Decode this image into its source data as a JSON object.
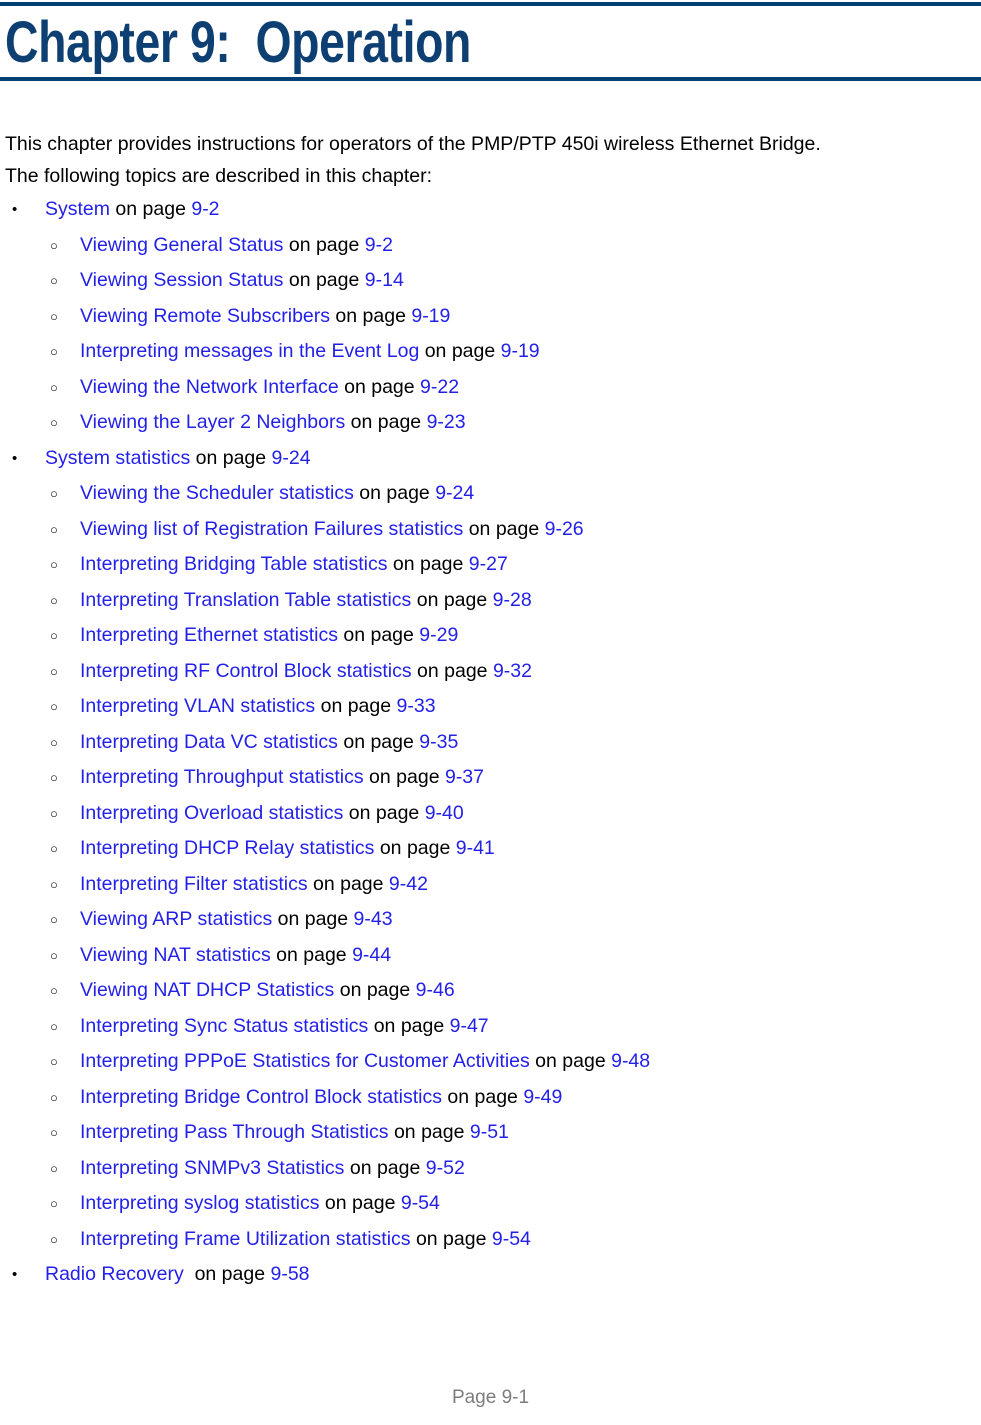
{
  "header": {
    "title": "Chapter 9:  Operation",
    "rule_color": "#024073",
    "title_color": "#0d3f72"
  },
  "intro": {
    "line1": "This chapter provides instructions for operators of the PMP/PTP 450i wireless Ethernet Bridge.",
    "line2": "The following topics are described in this chapter:"
  },
  "colors": {
    "link": "#2321e8",
    "text": "#000000",
    "footer": "#7d7d7d"
  },
  "connector": " on page ",
  "toc": [
    {
      "level": 1,
      "bullet": "•",
      "title": "System",
      "connector": " on page ",
      "page": "9-2"
    },
    {
      "level": 2,
      "bullet": "○",
      "title": "Viewing General Status",
      "connector": " on page ",
      "page": "9-2"
    },
    {
      "level": 2,
      "bullet": "○",
      "title": "Viewing Session Status",
      "connector": " on page ",
      "page": "9-14"
    },
    {
      "level": 2,
      "bullet": "○",
      "title": "Viewing Remote Subscribers",
      "connector": " on page ",
      "page": "9-19"
    },
    {
      "level": 2,
      "bullet": "○",
      "title": "Interpreting messages in the Event Log",
      "connector": " on page ",
      "page": "9-19"
    },
    {
      "level": 2,
      "bullet": "○",
      "title": "Viewing the Network Interface",
      "connector": " on page ",
      "page": "9-22"
    },
    {
      "level": 2,
      "bullet": "○",
      "title": "Viewing the Layer 2 Neighbors",
      "connector": " on page ",
      "page": "9-23"
    },
    {
      "level": 1,
      "bullet": "•",
      "title": "System statistics",
      "connector": " on page ",
      "page": "9-24"
    },
    {
      "level": 2,
      "bullet": "○",
      "title": "Viewing the Scheduler statistics",
      "connector": " on page ",
      "page": "9-24"
    },
    {
      "level": 2,
      "bullet": "○",
      "title": "Viewing list of Registration Failures statistics",
      "connector": " on page ",
      "page": "9-26"
    },
    {
      "level": 2,
      "bullet": "○",
      "title": "Interpreting Bridging Table statistics",
      "connector": " on page ",
      "page": "9-27"
    },
    {
      "level": 2,
      "bullet": "○",
      "title": "Interpreting Translation Table statistics",
      "connector": " on page ",
      "page": "9-28"
    },
    {
      "level": 2,
      "bullet": "○",
      "title": "Interpreting Ethernet statistics",
      "connector": " on page ",
      "page": "9-29"
    },
    {
      "level": 2,
      "bullet": "○",
      "title": "Interpreting RF Control Block statistics",
      "connector": " on page ",
      "page": "9-32"
    },
    {
      "level": 2,
      "bullet": "○",
      "title": "Interpreting VLAN statistics",
      "connector": " on page ",
      "page": "9-33"
    },
    {
      "level": 2,
      "bullet": "○",
      "title": "Interpreting Data VC statistics",
      "connector": " on page ",
      "page": "9-35"
    },
    {
      "level": 2,
      "bullet": "○",
      "title": "Interpreting Throughput statistics",
      "connector": " on page ",
      "page": "9-37"
    },
    {
      "level": 2,
      "bullet": "○",
      "title": "Interpreting Overload statistics",
      "connector": " on page ",
      "page": "9-40"
    },
    {
      "level": 2,
      "bullet": "○",
      "title": "Interpreting DHCP Relay statistics",
      "connector": " on page ",
      "page": "9-41"
    },
    {
      "level": 2,
      "bullet": "○",
      "title": "Interpreting Filter statistics",
      "connector": " on page ",
      "page": "9-42"
    },
    {
      "level": 2,
      "bullet": "○",
      "title": "Viewing ARP statistics",
      "connector": " on page ",
      "page": "9-43"
    },
    {
      "level": 2,
      "bullet": "○",
      "title": "Viewing NAT statistics",
      "connector": " on page ",
      "page": "9-44"
    },
    {
      "level": 2,
      "bullet": "○",
      "title": "Viewing NAT DHCP Statistics",
      "connector": " on page ",
      "page": "9-46"
    },
    {
      "level": 2,
      "bullet": "○",
      "title": "Interpreting Sync Status statistics",
      "connector": " on page ",
      "page": "9-47"
    },
    {
      "level": 2,
      "bullet": "○",
      "title": "Interpreting PPPoE Statistics for Customer Activities",
      "connector": " on page ",
      "page": "9-48"
    },
    {
      "level": 2,
      "bullet": "○",
      "title": "Interpreting Bridge Control Block statistics",
      "connector": " on page ",
      "page": "9-49"
    },
    {
      "level": 2,
      "bullet": "○",
      "title": "Interpreting Pass Through Statistics",
      "connector": " on page ",
      "page": "9-51"
    },
    {
      "level": 2,
      "bullet": "○",
      "title": "Interpreting SNMPv3 Statistics",
      "connector": " on page ",
      "page": "9-52"
    },
    {
      "level": 2,
      "bullet": "○",
      "title": "Interpreting syslog statistics",
      "connector": " on page ",
      "page": "9-54"
    },
    {
      "level": 2,
      "bullet": "○",
      "title": "Interpreting Frame Utilization statistics",
      "connector": " on page ",
      "page": "9-54"
    },
    {
      "level": 1,
      "bullet": "•",
      "title": "Radio Recovery ",
      "connector": " on page ",
      "page": "9-58"
    }
  ],
  "footer": {
    "page_label": "Page 9-1"
  }
}
